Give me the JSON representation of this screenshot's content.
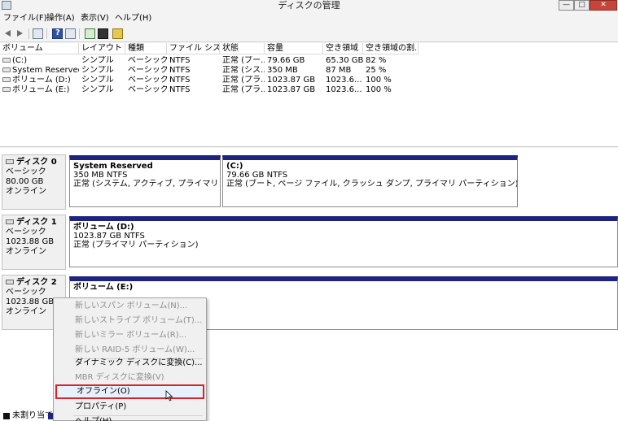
{
  "window": {
    "title": "ディスクの管理",
    "buttons": {
      "minimize": "—",
      "maximize": "□",
      "close": "✕"
    }
  },
  "menubar": [
    {
      "label": "ファイル(F)"
    },
    {
      "label": "操作(A)"
    },
    {
      "label": "表示(V)"
    },
    {
      "label": "ヘルプ(H)"
    }
  ],
  "toolbar": {
    "icons": [
      "back-arrow-icon",
      "forward-arrow-icon",
      "console-tree-icon",
      "help-icon",
      "properties-icon",
      "refresh-icon",
      "settings-icon",
      "rescan-disk-icon"
    ]
  },
  "volume_list": {
    "columns": [
      "ボリューム",
      "レイアウト",
      "種類",
      "ファイル シス...",
      "状態",
      "容量",
      "空き領域",
      "空き領域の割..."
    ],
    "rows": [
      [
        "(C:)",
        "シンプル",
        "ベーシック",
        "NTFS",
        "正常 (ブー...",
        "79.66 GB",
        "65.30 GB",
        "82 %"
      ],
      [
        "System Reserved",
        "シンプル",
        "ベーシック",
        "NTFS",
        "正常 (シス...",
        "350 MB",
        "87 MB",
        "25 %"
      ],
      [
        "ボリューム (D:)",
        "シンプル",
        "ベーシック",
        "NTFS",
        "正常 (プラ...",
        "1023.87 GB",
        "1023.6...",
        "100 %"
      ],
      [
        "ボリューム (E:)",
        "シンプル",
        "ベーシック",
        "NTFS",
        "正常 (プラ...",
        "1023.87 GB",
        "1023.6...",
        "100 %"
      ]
    ]
  },
  "disks": [
    {
      "name": "ディスク 0",
      "type": "ベーシック",
      "size": "80.00 GB",
      "status": "オンライン",
      "partitions": [
        {
          "name": "System Reserved",
          "size": "350 MB NTFS",
          "status": "正常 (システム, アクティブ, プライマリ パーティション"
        },
        {
          "name": "(C:)",
          "size": "79.66 GB NTFS",
          "status": "正常 (ブート, ページ ファイル, クラッシュ ダンプ, プライマリ パーティション)"
        }
      ]
    },
    {
      "name": "ディスク 1",
      "type": "ベーシック",
      "size": "1023.88 GB",
      "status": "オンライン",
      "partitions": [
        {
          "name": "ボリューム (D:)",
          "size": "1023.87 GB NTFS",
          "status": "正常 (プライマリ パーティション)"
        }
      ]
    },
    {
      "name": "ディスク 2",
      "type": "ベーシック",
      "size": "1023.88 GB",
      "status": "オンライン",
      "partitions": [
        {
          "name": "ボリューム (E:)"
        }
      ]
    }
  ],
  "context_menu": {
    "items": [
      {
        "label": "新しいスパン ボリューム(N)...",
        "enabled": false
      },
      {
        "label": "新しいストライプ ボリューム(T)...",
        "enabled": false
      },
      {
        "label": "新しいミラー ボリューム(R)...",
        "enabled": false
      },
      {
        "label": "新しい RAID-5 ボリューム(W)...",
        "enabled": false
      },
      {
        "label": "ダイナミック ディスクに変換(C)...",
        "enabled": true
      },
      {
        "label": "MBR ディスクに変換(V)",
        "enabled": false
      },
      {
        "label": "オフライン(O)",
        "enabled": true,
        "highlighted": true
      },
      {
        "label": "プロパティ(P)",
        "enabled": true
      },
      {
        "label": "ヘルプ(H)",
        "enabled": true
      }
    ]
  },
  "legend": {
    "items": [
      {
        "label": "未割り当て",
        "color": "#111111"
      },
      {
        "label": "",
        "color": "#1e2380"
      }
    ]
  },
  "colors": {
    "partition_header": "#1e2380",
    "highlight_border": "#d9232a",
    "highlight_fill": "#e7f1fb"
  }
}
